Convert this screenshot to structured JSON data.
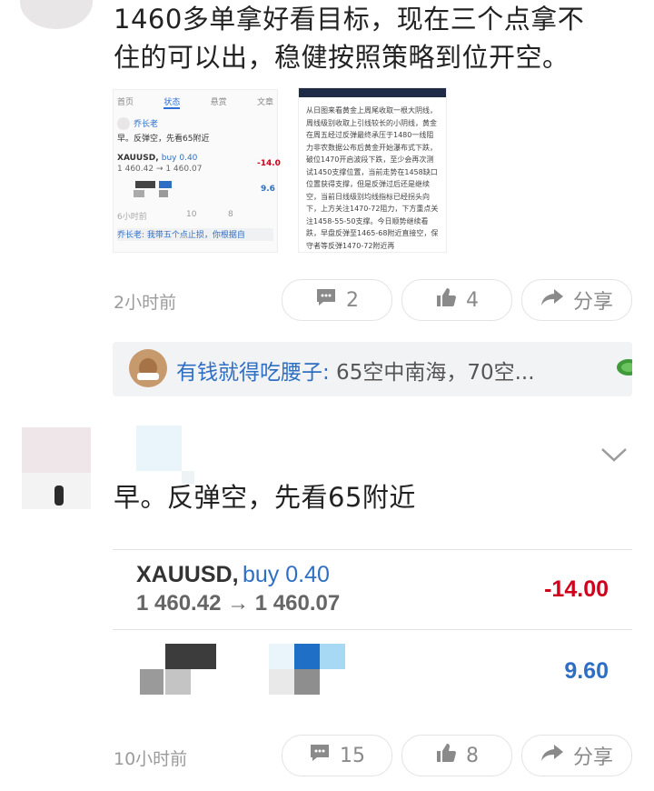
{
  "post1": {
    "text_line1": "1460多单拿好看目标，现在三个点拿不",
    "text_line2": "住的可以出，稳健按照策略到位开空。",
    "thumb_left": {
      "tabs": [
        "首页",
        "状态",
        "悬赏",
        "文章"
      ],
      "author": "乔长老",
      "text": "早。反弹空，先看65附近",
      "symbol": "XAUUSD,",
      "side": "buy 0.40",
      "prices": "1 460.42 → 1 460.07",
      "pnl": "-14.0",
      "pnl2": "9.6",
      "time": "6小时前",
      "comments": "10",
      "likes": "8",
      "reply": "乔长老: 我带五个点止损，你根据自"
    },
    "thumb_right": {
      "text": "从日图来看黄金上周尾收取一根大阴线，周线级别收取上引线较长的小阴线，黄金在周五经过反弹最终承压于1480一线阻力非农数据公布后黄金开始瀑布式下跌，破位1470开启波段下跌，至少会再次测试1450支撑位置，当前走势在1458缺口位置获得支撑，但是反弹过后还是继续空，当前日线级别均线指标已经拐头向下，上方关注1470-72阻力，下方重点关注1458-55-50支撑。今日顺势继续看跌，早盘反弹至1465-68附近直接空，保守者等反弹1470-72附近再"
    },
    "time": "2小时前",
    "comments": "2",
    "likes": "4",
    "share": "分享",
    "reply": {
      "name": "有钱就得吃腰子:",
      "text": " 65空中南海，70空..."
    }
  },
  "post2": {
    "text": "早。反弹空，先看65附近",
    "trade": {
      "symbol": "XAUUSD,",
      "side": "buy 0.40",
      "prices": "1 460.42 → 1 460.07",
      "pnl": "-14.00",
      "pnl2": "9.60"
    },
    "time": "10小时前",
    "comments": "15",
    "likes": "8",
    "share": "分享"
  },
  "icons": [
    "comment-icon",
    "thumbs-up-icon",
    "share-arrow-icon",
    "chevron-down-icon",
    "turtle-icon"
  ],
  "colors": {
    "link_blue": "#2e6fc4",
    "loss_red": "#d0021b",
    "muted": "#9b9b9b"
  }
}
